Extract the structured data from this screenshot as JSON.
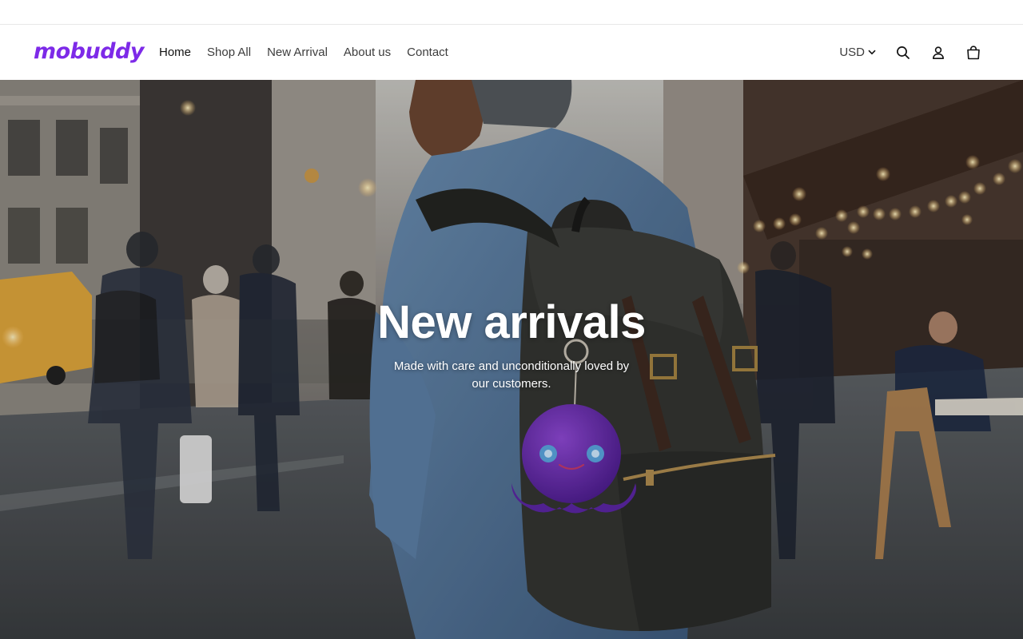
{
  "brand": {
    "logo_text": "mobuddy",
    "color": "#7d2ae8"
  },
  "nav": {
    "items": [
      {
        "label": "Home",
        "active": true
      },
      {
        "label": "Shop All"
      },
      {
        "label": "New Arrival"
      },
      {
        "label": "About us"
      },
      {
        "label": "Contact"
      }
    ]
  },
  "header": {
    "currency": "USD",
    "icons": [
      "search-icon",
      "account-icon",
      "cart-icon"
    ]
  },
  "hero": {
    "title": "New arrivals",
    "subtitle": "Made with care and unconditionally loved by our customers."
  }
}
